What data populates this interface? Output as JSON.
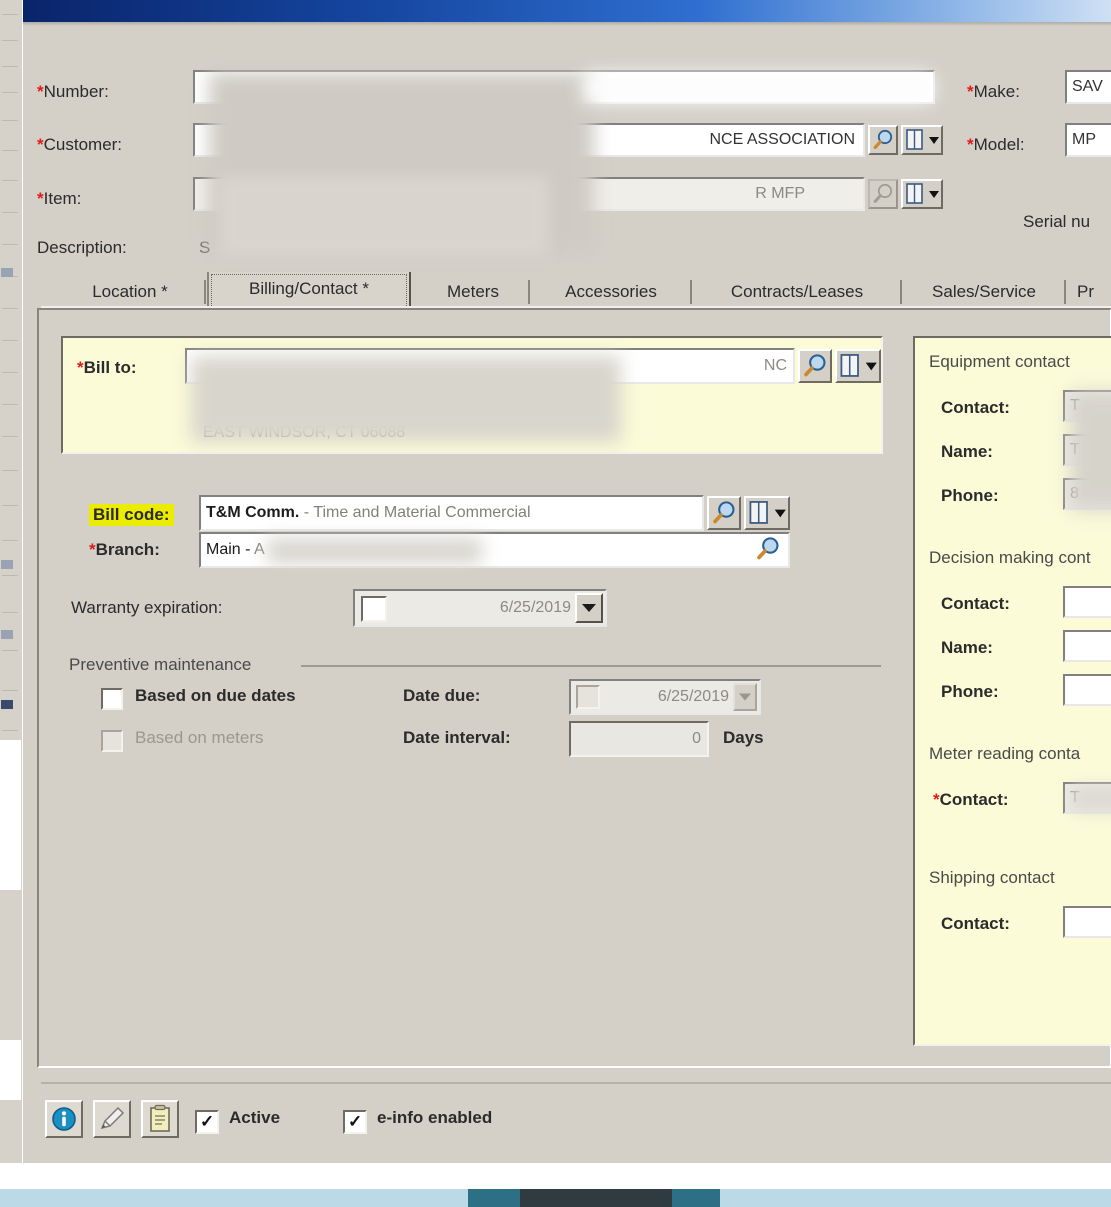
{
  "window": {
    "title": "",
    "accent_titlebar": "#0a246a",
    "face_color": "#d4d0c8",
    "panel_yellow": "#fbfbd8",
    "highlight_yellow": "#ecec00",
    "required_marker": "*"
  },
  "header": {
    "fields": [
      {
        "label": "Number:",
        "required": true,
        "value": "",
        "redacted": true,
        "has_search": false,
        "has_drill": false
      },
      {
        "label": "Customer:",
        "required": true,
        "value": "NCE ASSOCIATION",
        "redacted": true,
        "has_search": true,
        "has_drill": true
      },
      {
        "label": "Item:",
        "required": true,
        "value": "R MFP",
        "redacted": true,
        "has_search": true,
        "has_drill": true
      },
      {
        "label": "Description:",
        "required": false,
        "value": "S",
        "redacted": true,
        "has_search": false,
        "has_drill": false
      }
    ],
    "right_fields": [
      {
        "label": "Make:",
        "required": true,
        "value": "SAV"
      },
      {
        "label": "Model:",
        "required": true,
        "value": "MP"
      }
    ],
    "serial_label": "Serial nu"
  },
  "tabs": [
    {
      "label": "Location *",
      "selected": false
    },
    {
      "label": "Billing/Contact *",
      "selected": true
    },
    {
      "label": "Meters",
      "selected": false
    },
    {
      "label": "Accessories",
      "selected": false
    },
    {
      "label": "Contracts/Leases",
      "selected": false
    },
    {
      "label": "Sales/Service",
      "selected": false
    },
    {
      "label": "Pr",
      "selected": false
    }
  ],
  "billing": {
    "bill_to": {
      "label": "Bill to:",
      "required": true,
      "value": "NC",
      "address_line": "EAST WINDSOR, CT 06088",
      "redacted": true,
      "search_icon": "magnifier-icon",
      "drill_icon": "drill-down-icon"
    },
    "bill_code": {
      "label": "Bill code:",
      "highlighted": true,
      "value_code": "T&M Comm.",
      "value_desc": "- Time and Material Commercial",
      "search_icon": "magnifier-icon",
      "drill_icon": "drill-down-icon"
    },
    "branch": {
      "label": "Branch:",
      "required": true,
      "value_code": "Main -",
      "value_desc": "A",
      "redacted": true,
      "search_icon": "magnifier-icon"
    },
    "warranty": {
      "label": "Warranty expiration:",
      "checked": false,
      "date": "6/25/2019",
      "enabled": false
    },
    "preventive_maintenance": {
      "group_label": "Preventive maintenance",
      "based_on_due_dates": {
        "label": "Based on due dates",
        "checked": false,
        "enabled": true
      },
      "based_on_meters": {
        "label": "Based on meters",
        "checked": false,
        "enabled": false
      },
      "date_due": {
        "label": "Date due:",
        "checked": false,
        "date": "6/25/2019",
        "enabled": false
      },
      "date_interval": {
        "label": "Date interval:",
        "value": "0",
        "units": "Days",
        "enabled": false
      }
    }
  },
  "contacts": {
    "groups": [
      {
        "title": "Equipment contact",
        "rows": [
          {
            "label": "Contact:",
            "required": false,
            "value": "T",
            "redacted": true
          },
          {
            "label": "Name:",
            "required": false,
            "value": "T",
            "redacted": true
          },
          {
            "label": "Phone:",
            "required": false,
            "value": "8",
            "redacted": true
          }
        ]
      },
      {
        "title": "Decision making cont",
        "rows": [
          {
            "label": "Contact:",
            "required": false,
            "value": "",
            "redacted": false
          },
          {
            "label": "Name:",
            "required": false,
            "value": "",
            "redacted": false
          },
          {
            "label": "Phone:",
            "required": false,
            "value": "",
            "redacted": false
          }
        ]
      },
      {
        "title": "Meter reading conta",
        "rows": [
          {
            "label": "Contact:",
            "required": true,
            "value": "T",
            "redacted": true
          }
        ]
      },
      {
        "title": "Shipping contact",
        "rows": [
          {
            "label": "Contact:",
            "required": false,
            "value": "",
            "redacted": false
          }
        ]
      }
    ]
  },
  "footer": {
    "buttons": [
      {
        "name": "info-button",
        "icon": "info-icon"
      },
      {
        "name": "attachment-button",
        "icon": "pencil-icon"
      },
      {
        "name": "notes-button",
        "icon": "notepad-icon"
      }
    ],
    "checkboxes": [
      {
        "label": "Active",
        "checked": true
      },
      {
        "label": "e-info enabled",
        "checked": true
      }
    ]
  }
}
